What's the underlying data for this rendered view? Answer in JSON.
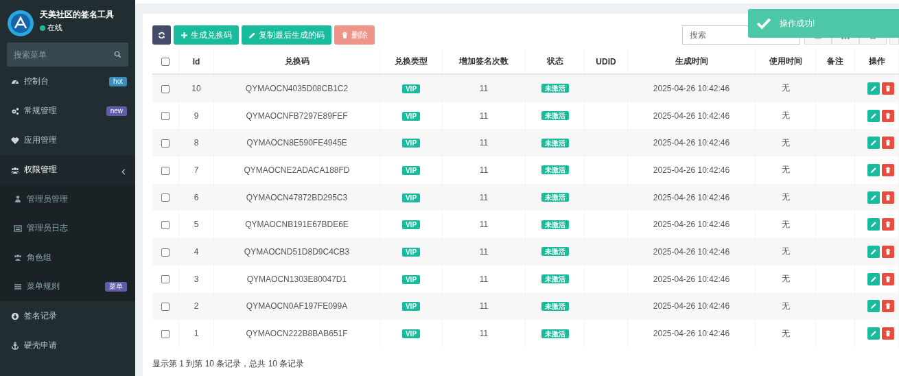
{
  "sidebar": {
    "brand": "天美社区的签名工具",
    "status": "在线",
    "search": {
      "placeholder": "搜索菜单"
    },
    "menu": [
      {
        "label": "控制台",
        "badge": "hot",
        "color": "#3c8dbc",
        "expanded": false
      },
      {
        "label": "常规管理",
        "badge": "new",
        "color": "#605ca8",
        "expanded": false
      },
      {
        "label": "应用管理",
        "expanded": false
      },
      {
        "label": "权限管理",
        "expanded": true,
        "children": [
          {
            "label": "管理员管理"
          },
          {
            "label": "管理员日志"
          },
          {
            "label": "角色组"
          },
          {
            "label": "菜单规则",
            "badge": "菜单",
            "color": "#605ca8"
          }
        ]
      },
      {
        "label": "签名记录",
        "expanded": false
      },
      {
        "label": "硬壳申请",
        "expanded": false
      }
    ]
  },
  "toolbar": {
    "buttons": [
      {
        "kind": "refresh",
        "disabled": false
      },
      {
        "kind": "add",
        "label": "生成兑换码",
        "disabled": false
      },
      {
        "kind": "copy",
        "label": "复制最后生成的码",
        "disabled": false
      },
      {
        "kind": "delete",
        "label": "删除",
        "disabled": true
      }
    ],
    "search": {
      "placeholder": "搜索"
    }
  },
  "toast": {
    "message": "操作成功!"
  },
  "table": {
    "all_checked": false,
    "columns": [
      "Id",
      "兑换码",
      "兑换类型",
      "增加签名次数",
      "状态",
      "UDID",
      "生成时间",
      "使用时间",
      "备注",
      "操作"
    ],
    "rows": [
      {
        "checked": false,
        "id": "10",
        "code": "QYMAOCN4035D08CB1C2",
        "type": "VIP",
        "count": "11",
        "status": "未激活",
        "created": "2025-04-26 10:42:46",
        "used": "无"
      },
      {
        "checked": false,
        "id": "9",
        "code": "QYMAOCNFB7297E89FEF",
        "type": "VIP",
        "count": "11",
        "status": "未激活",
        "created": "2025-04-26 10:42:46",
        "used": "无"
      },
      {
        "checked": false,
        "id": "8",
        "code": "QYMAOCN8E590FE4945E",
        "type": "VIP",
        "count": "11",
        "status": "未激活",
        "created": "2025-04-26 10:42:46",
        "used": "无"
      },
      {
        "checked": false,
        "id": "7",
        "code": "QYMAOCNE2ADACA188FD",
        "type": "VIP",
        "count": "11",
        "status": "未激活",
        "created": "2025-04-26 10:42:46",
        "used": "无"
      },
      {
        "checked": false,
        "id": "6",
        "code": "QYMAOCN47872BD295C3",
        "type": "VIP",
        "count": "11",
        "status": "未激活",
        "created": "2025-04-26 10:42:46",
        "used": "无"
      },
      {
        "checked": false,
        "id": "5",
        "code": "QYMAOCNB191E67BDE6E",
        "type": "VIP",
        "count": "11",
        "status": "未激活",
        "created": "2025-04-26 10:42:46",
        "used": "无"
      },
      {
        "checked": false,
        "id": "4",
        "code": "QYMAOCND51D8D9C4CB3",
        "type": "VIP",
        "count": "11",
        "status": "未激活",
        "created": "2025-04-26 10:42:46",
        "used": "无"
      },
      {
        "checked": false,
        "id": "3",
        "code": "QYMAOCN1303E80047D1",
        "type": "VIP",
        "count": "11",
        "status": "未激活",
        "created": "2025-04-26 10:42:46",
        "used": "无"
      },
      {
        "checked": false,
        "id": "2",
        "code": "QYMAOCN0AF197FE099A",
        "type": "VIP",
        "count": "11",
        "status": "未激活",
        "created": "2025-04-26 10:42:46",
        "used": "无"
      },
      {
        "checked": false,
        "id": "1",
        "code": "QYMAOCN222B8BAB651F",
        "type": "VIP",
        "count": "11",
        "status": "未激活",
        "created": "2025-04-26 10:42:46",
        "used": "无"
      }
    ]
  },
  "footer": "显示第 1 到第 10 条记录，总共 10 条记录"
}
